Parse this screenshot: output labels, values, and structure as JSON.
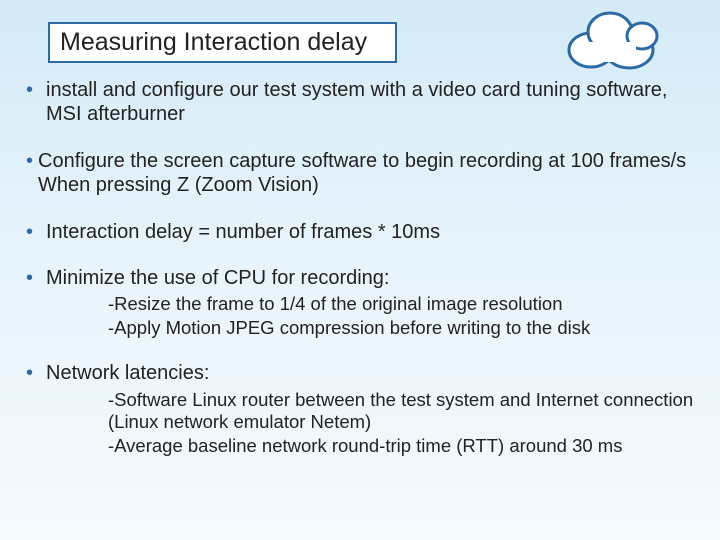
{
  "title": "Measuring Interaction delay",
  "bullets": [
    {
      "text": "install and configure our test system with a video card tuning software, MSI afterburner",
      "sub": []
    },
    {
      "text": "Configure the screen capture software to begin recording at 100 frames/s When pressing Z (Zoom Vision)",
      "sub": []
    },
    {
      "text": "Interaction delay = number of frames * 10ms",
      "sub": []
    },
    {
      "text": "Minimize the use of CPU for recording:",
      "sub": [
        "-Resize the frame to 1/4 of the original image resolution",
        "-Apply Motion JPEG compression before writing to the disk"
      ]
    },
    {
      "text": "Network latencies:",
      "sub": [
        "-Software Linux router between the test system and Internet connection (Linux network emulator Netem)",
        "-Average baseline network round-trip time (RTT) around 30 ms"
      ]
    }
  ]
}
